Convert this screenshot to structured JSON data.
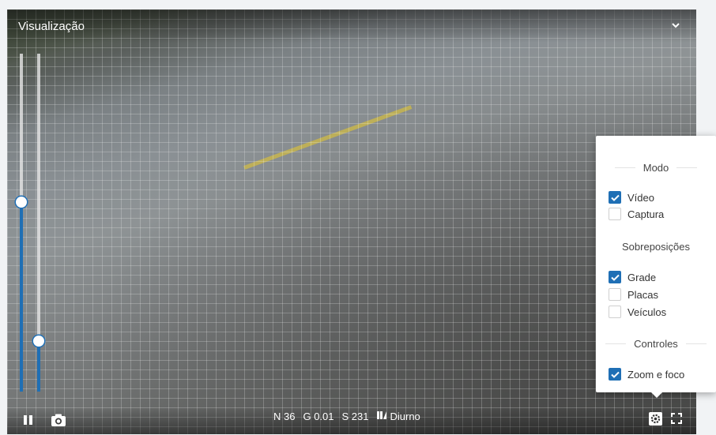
{
  "viewer": {
    "title": "Visualização",
    "collapse_icon": "chevron-down-icon",
    "sliders": [
      {
        "name": "slider-left",
        "level": 0.56
      },
      {
        "name": "slider-right",
        "level": 0.15
      }
    ]
  },
  "controls": {
    "pause_icon": "pause-icon",
    "camera_icon": "camera-icon",
    "settings_icon": "gear-icon",
    "fullscreen_icon": "fullscreen-icon"
  },
  "status": {
    "n": "N 36",
    "g": "G 0.01",
    "s": "S 231",
    "mode_icon": "day-night-icon",
    "mode": "Diurno"
  },
  "settings_menu": {
    "modo": {
      "title": "Modo",
      "options": [
        {
          "label": "Vídeo",
          "checked": true
        },
        {
          "label": "Captura",
          "checked": false
        }
      ]
    },
    "sobreposicoes": {
      "title": "Sobreposições",
      "options": [
        {
          "label": "Grade",
          "checked": true
        },
        {
          "label": "Placas",
          "checked": false
        },
        {
          "label": "Veículos",
          "checked": false
        }
      ]
    },
    "controles": {
      "title": "Controles",
      "options": [
        {
          "label": "Zoom e foco",
          "checked": true
        }
      ]
    }
  },
  "colors": {
    "accent": "#1f6fb5",
    "menu_bg": "#ffffff",
    "road_grid": "rgba(255,255,255,0.22)"
  }
}
